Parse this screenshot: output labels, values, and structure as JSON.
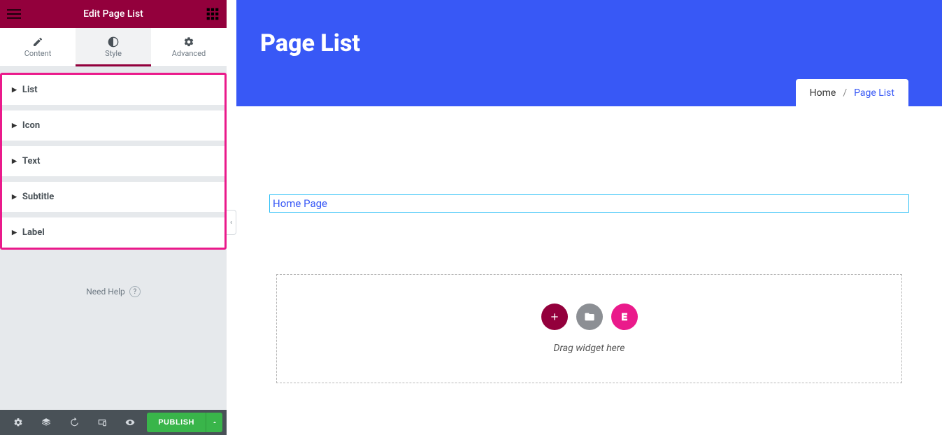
{
  "sidebar": {
    "title": "Edit Page List",
    "tabs": [
      {
        "label": "Content"
      },
      {
        "label": "Style"
      },
      {
        "label": "Advanced"
      }
    ],
    "sections": [
      {
        "label": "List"
      },
      {
        "label": "Icon"
      },
      {
        "label": "Text"
      },
      {
        "label": "Subtitle"
      },
      {
        "label": "Label"
      }
    ],
    "help_text": "Need Help",
    "publish_label": "PUBLISH"
  },
  "canvas": {
    "hero_title": "Page List",
    "breadcrumb": {
      "home": "Home",
      "separator": "/",
      "current": "Page List"
    },
    "selected_widget_text": "Home Page",
    "drop_hint": "Drag widget here"
  }
}
